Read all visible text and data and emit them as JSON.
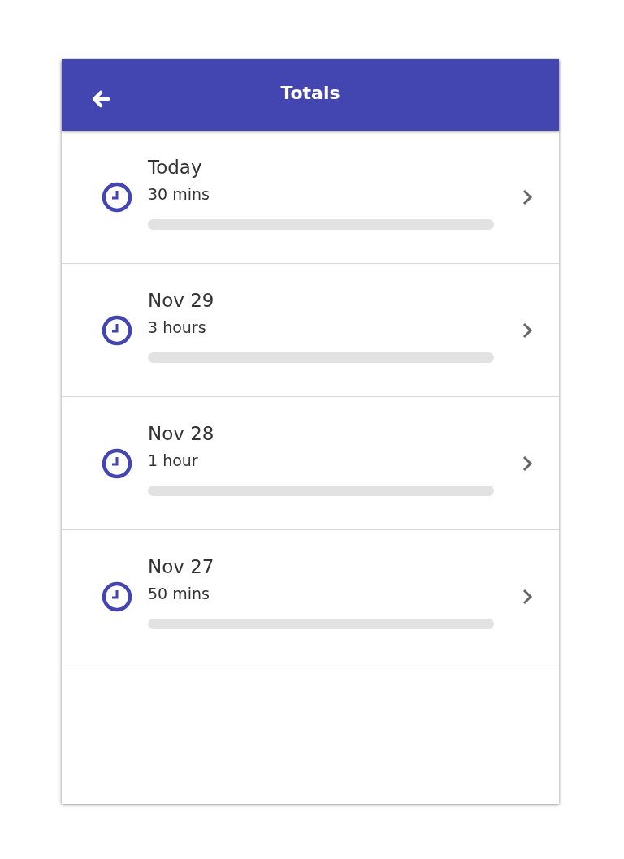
{
  "header": {
    "title": "Totals"
  },
  "entries": [
    {
      "title": "Today",
      "duration": "30 mins"
    },
    {
      "title": "Nov 29",
      "duration": "3 hours"
    },
    {
      "title": "Nov 28",
      "duration": "1 hour"
    },
    {
      "title": "Nov 27",
      "duration": "50 mins"
    }
  ]
}
